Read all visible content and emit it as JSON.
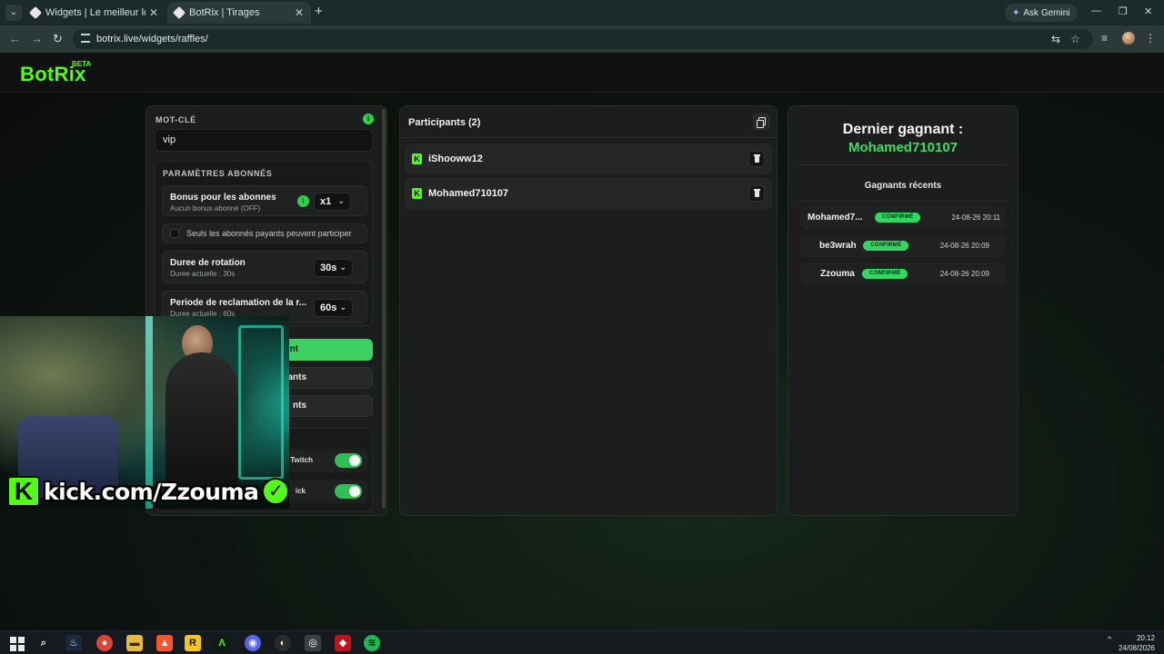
{
  "browser": {
    "tabs": [
      {
        "title": "Widgets | Le meilleur logiciel p",
        "active": false
      },
      {
        "title": "BotRix | Tirages",
        "active": true
      }
    ],
    "ask_gemini": "Ask Gemini",
    "url": "botrix.live/widgets/raffles/"
  },
  "app": {
    "logo": "BotRix",
    "badge": "BETA"
  },
  "settings": {
    "keyword_label": "MOT-CLÉ",
    "keyword_value": "vip",
    "subs_section": "PARAMÈTRES ABONNÉS",
    "bonus_title": "Bonus pour les abonnes",
    "bonus_sub": "Aucun bonus abonné (OFF)",
    "bonus_value": "x1",
    "paid_only_label": "Seuls les abonnés payants peuvent participer",
    "rotation_title": "Duree de rotation",
    "rotation_sub": "Duree actuelle : 30s",
    "rotation_value": "30s",
    "claim_title": "Periode de reclamation de la r...",
    "claim_sub": "Duree actuelle : 60s",
    "claim_value": "60s",
    "btn_start_fragment": "nt",
    "btn_participants_fragment": "ants",
    "btn_third_fragment": "nts",
    "platform1_fragment": "Twitch",
    "platform2_fragment": "ick"
  },
  "participants": {
    "title": "Participants (2)",
    "list": [
      "iShooww12",
      "Mohamed710107"
    ]
  },
  "winner": {
    "title": "Dernier gagnant :",
    "name": "Mohamed710107",
    "recent_title": "Gagnants récents",
    "recent": [
      {
        "name": "Mohamed7...",
        "status": "CONFIRMÉ",
        "date": "24-08-26 20:11"
      },
      {
        "name": "be3wrah",
        "status": "CONFIRMÉ",
        "date": "24-08-26 20:09"
      },
      {
        "name": "Zzouma",
        "status": "CONFIRMÉ",
        "date": "24-08-26 20:09"
      }
    ]
  },
  "overlay": {
    "kick_text": "kick.com/Zzouma"
  },
  "taskbar": {
    "time": "20:12",
    "date": "24/08/2026"
  },
  "colors": {
    "accent": "#53fc18",
    "badge_green": "#2fd863",
    "panel": "#1c1e1d"
  }
}
